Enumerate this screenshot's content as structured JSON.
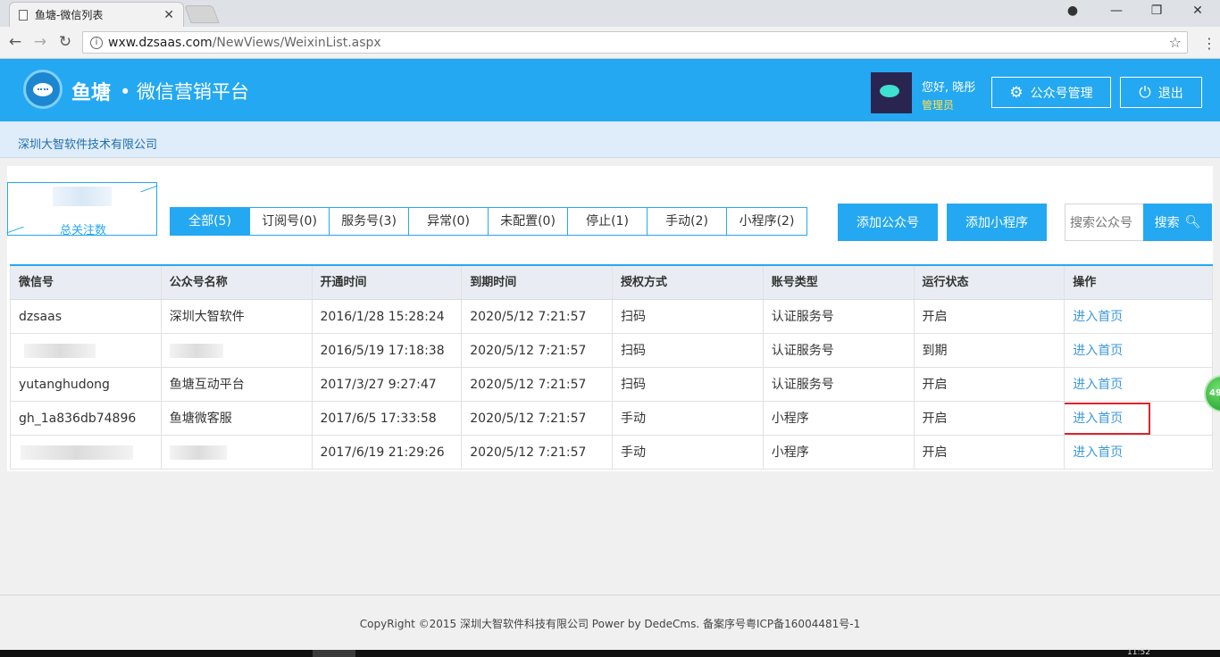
{
  "browser": {
    "tab_title": "鱼塘-微信列表",
    "url_host": "wxw.dzsaas.com",
    "url_path": "/NewViews/WeixinList.aspx"
  },
  "header": {
    "brand": "鱼塘",
    "brand_sub": "• 微信营销平台",
    "greeting": "您好, 晓彤",
    "role": "管理员",
    "manage_btn": "公众号管理",
    "logout_btn": "退出"
  },
  "company": "深圳大智软件技术有限公司",
  "follow_label": "总关注数",
  "filters": [
    "全部(5)",
    "订阅号(0)",
    "服务号(3)",
    "异常(0)",
    "未配置(0)",
    "停止(1)",
    "手动(2)",
    "小程序(2)"
  ],
  "actions": {
    "add_account": "添加公众号",
    "add_miniapp": "添加小程序",
    "search_placeholder": "搜索公众号",
    "search_btn": "搜索"
  },
  "table": {
    "headers": [
      "微信号",
      "公众号名称",
      "开通时间",
      "到期时间",
      "授权方式",
      "账号类型",
      "运行状态",
      "操作"
    ],
    "rows": [
      [
        "dzsaas",
        "深圳大智软件",
        "2016/1/28 15:28:24",
        "2020/5/12 7:21:57",
        "扫码",
        "认证服务号",
        "开启",
        "进入首页"
      ],
      [
        "",
        "",
        "2016/5/19 17:18:38",
        "2020/5/12 7:21:57",
        "扫码",
        "认证服务号",
        "到期",
        "进入首页"
      ],
      [
        "yutanghudong",
        "鱼塘互动平台",
        "2017/3/27 9:27:47",
        "2020/5/12 7:21:57",
        "扫码",
        "认证服务号",
        "开启",
        "进入首页"
      ],
      [
        "gh_1a836db74896",
        "鱼塘微客服",
        "2017/6/5 17:33:58",
        "2020/5/12 7:21:57",
        "手动",
        "小程序",
        "开启",
        "进入首页"
      ],
      [
        "",
        "",
        "2017/6/19 21:29:26",
        "2020/5/12 7:21:57",
        "手动",
        "小程序",
        "开启",
        "进入首页"
      ]
    ]
  },
  "fab_badge": "49",
  "footer": "CopyRight ©2015 深圳大智软件科技有限公司 Power by DedeCms. 备案序号粤ICP备16004481号-1",
  "taskbar_clock": "11:52"
}
